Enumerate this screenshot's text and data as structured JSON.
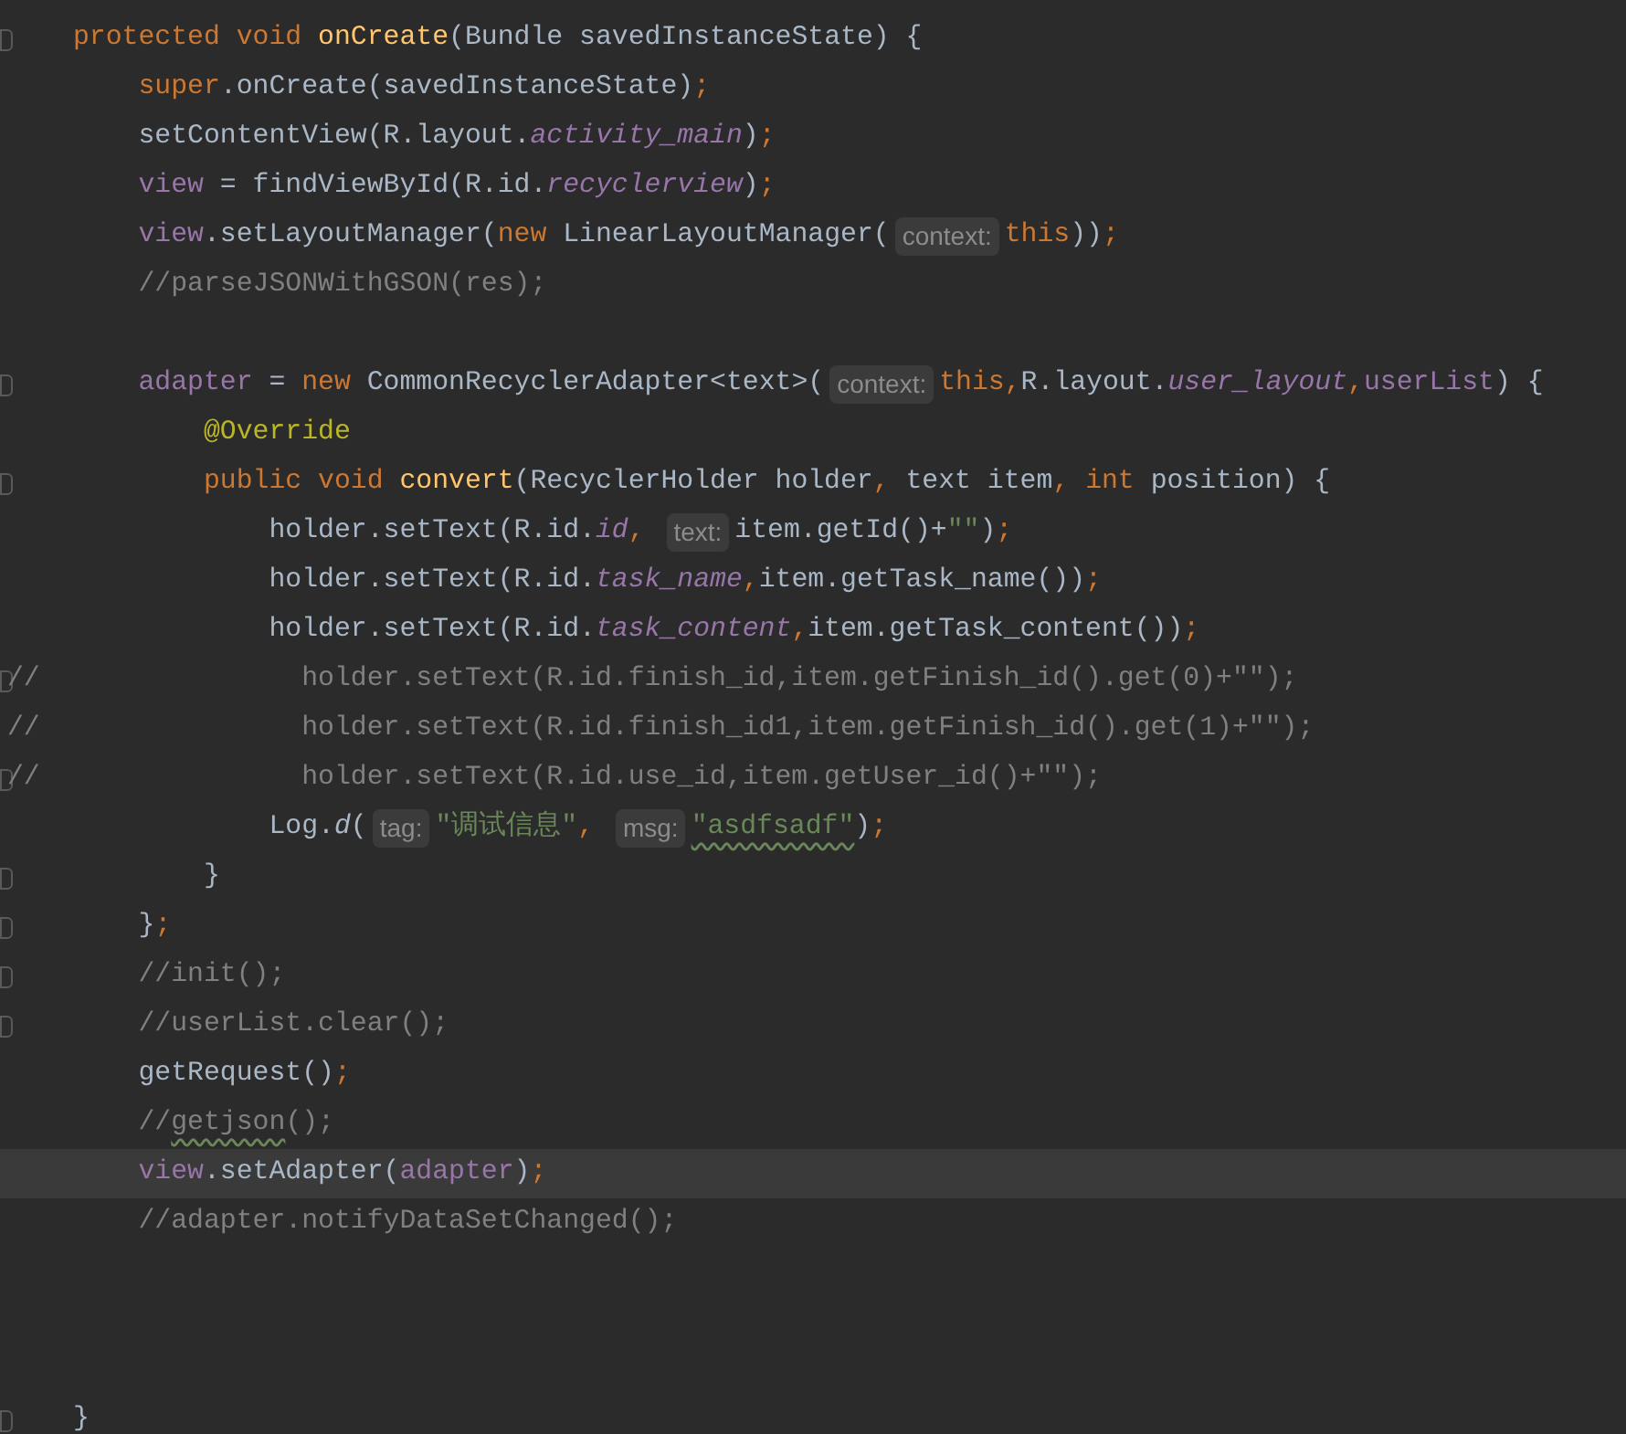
{
  "editor": {
    "lines": [
      {
        "fold": true,
        "current": false,
        "tokens": [
          {
            "kind": "keyword",
            "text": "protected void "
          },
          {
            "kind": "method",
            "text": "onCreate"
          },
          {
            "kind": "plain",
            "text": "(Bundle savedInstanceState) {"
          }
        ]
      },
      {
        "fold": false,
        "current": false,
        "tokens": [
          {
            "kind": "keyword",
            "text": "    super"
          },
          {
            "kind": "plain",
            "text": ".onCreate(savedInstanceState)"
          },
          {
            "kind": "punct",
            "text": ";"
          }
        ]
      },
      {
        "fold": false,
        "current": false,
        "tokens": [
          {
            "kind": "plain",
            "text": "    setContentView(R.layout."
          },
          {
            "kind": "field",
            "text": "activity_main"
          },
          {
            "kind": "plain",
            "text": ")"
          },
          {
            "kind": "punct",
            "text": ";"
          }
        ]
      },
      {
        "fold": false,
        "current": false,
        "tokens": [
          {
            "kind": "var",
            "text": "    view"
          },
          {
            "kind": "plain",
            "text": " = findViewById(R.id."
          },
          {
            "kind": "field",
            "text": "recyclerview"
          },
          {
            "kind": "plain",
            "text": ")"
          },
          {
            "kind": "punct",
            "text": ";"
          }
        ]
      },
      {
        "fold": false,
        "current": false,
        "tokens": [
          {
            "kind": "var",
            "text": "    view"
          },
          {
            "kind": "plain",
            "text": ".setLayoutManager("
          },
          {
            "kind": "keyword",
            "text": "new "
          },
          {
            "kind": "plain",
            "text": "LinearLayoutManager("
          },
          {
            "kind": "hint",
            "text": "context:"
          },
          {
            "kind": "keyword",
            "text": "this"
          },
          {
            "kind": "plain",
            "text": "))"
          },
          {
            "kind": "punct",
            "text": ";"
          }
        ]
      },
      {
        "fold": false,
        "current": false,
        "tokens": [
          {
            "kind": "comment",
            "text": "    //parseJSONWithGSON(res);"
          }
        ]
      },
      {
        "fold": false,
        "current": false
      },
      {
        "fold": true,
        "current": false,
        "tokens": [
          {
            "kind": "var",
            "text": "    adapter"
          },
          {
            "kind": "plain",
            "text": " = "
          },
          {
            "kind": "keyword",
            "text": "new "
          },
          {
            "kind": "plain",
            "text": "CommonRecyclerAdapter<text>("
          },
          {
            "kind": "hint",
            "text": "context:"
          },
          {
            "kind": "keyword",
            "text": "this"
          },
          {
            "kind": "punct",
            "text": ","
          },
          {
            "kind": "plain",
            "text": "R.layout."
          },
          {
            "kind": "field",
            "text": "user_layout"
          },
          {
            "kind": "punct",
            "text": ","
          },
          {
            "kind": "var",
            "text": "userList"
          },
          {
            "kind": "plain",
            "text": ") {"
          }
        ]
      },
      {
        "fold": false,
        "current": false,
        "tokens": [
          {
            "kind": "annotation",
            "text": "        @Override"
          }
        ]
      },
      {
        "fold": true,
        "current": false,
        "tokens": [
          {
            "kind": "keyword",
            "text": "        public void "
          },
          {
            "kind": "method",
            "text": "convert"
          },
          {
            "kind": "plain",
            "text": "(RecyclerHolder holder"
          },
          {
            "kind": "punct",
            "text": ", "
          },
          {
            "kind": "plain",
            "text": "text item"
          },
          {
            "kind": "punct",
            "text": ", "
          },
          {
            "kind": "keyword",
            "text": "int "
          },
          {
            "kind": "plain",
            "text": "position) {"
          }
        ]
      },
      {
        "fold": false,
        "current": false,
        "tokens": [
          {
            "kind": "plain",
            "text": "            holder.setText(R.id."
          },
          {
            "kind": "field",
            "text": "id"
          },
          {
            "kind": "punct",
            "text": ", "
          },
          {
            "kind": "hint",
            "text": "text:"
          },
          {
            "kind": "plain",
            "text": "item.getId()+"
          },
          {
            "kind": "string",
            "text": "\"\""
          },
          {
            "kind": "plain",
            "text": ")"
          },
          {
            "kind": "punct",
            "text": ";"
          }
        ]
      },
      {
        "fold": false,
        "current": false,
        "tokens": [
          {
            "kind": "plain",
            "text": "            holder.setText(R.id."
          },
          {
            "kind": "field",
            "text": "task_name"
          },
          {
            "kind": "punct",
            "text": ","
          },
          {
            "kind": "plain",
            "text": "item.getTask_name())"
          },
          {
            "kind": "punct",
            "text": ";"
          }
        ]
      },
      {
        "fold": false,
        "current": false,
        "tokens": [
          {
            "kind": "plain",
            "text": "            holder.setText(R.id."
          },
          {
            "kind": "field",
            "text": "task_content"
          },
          {
            "kind": "punct",
            "text": ","
          },
          {
            "kind": "plain",
            "text": "item.getTask_content())"
          },
          {
            "kind": "punct",
            "text": ";"
          }
        ]
      },
      {
        "fold": true,
        "current": false,
        "gutter_text": "//",
        "tokens": [
          {
            "kind": "comment",
            "text": "              holder.setText(R.id.finish_id,item.getFinish_id().get(0)+\"\");"
          }
        ]
      },
      {
        "fold": false,
        "current": false,
        "gutter_text": "//",
        "tokens": [
          {
            "kind": "comment",
            "text": "              holder.setText(R.id.finish_id1,item.getFinish_id().get(1)+\"\");"
          }
        ]
      },
      {
        "fold": true,
        "current": false,
        "gutter_text": "//",
        "tokens": [
          {
            "kind": "comment",
            "text": "              holder.setText(R.id.use_id,item.getUser_id()+\"\");"
          }
        ]
      },
      {
        "fold": false,
        "current": false,
        "tokens": [
          {
            "kind": "plain",
            "text": "            Log."
          },
          {
            "kind": "static",
            "text": "d"
          },
          {
            "kind": "plain",
            "text": "("
          },
          {
            "kind": "hint",
            "text": "tag:"
          },
          {
            "kind": "string",
            "text": "\"调试信息\""
          },
          {
            "kind": "punct",
            "text": ", "
          },
          {
            "kind": "hint",
            "text": "msg:"
          },
          {
            "kind": "string",
            "text": "\"asdfsadf\"",
            "typo": true
          },
          {
            "kind": "plain",
            "text": ")"
          },
          {
            "kind": "punct",
            "text": ";"
          }
        ]
      },
      {
        "fold": true,
        "current": false,
        "tokens": [
          {
            "kind": "plain",
            "text": "        }"
          }
        ]
      },
      {
        "fold": true,
        "current": false,
        "tokens": [
          {
            "kind": "plain",
            "text": "    }"
          },
          {
            "kind": "punct",
            "text": ";"
          }
        ]
      },
      {
        "fold": true,
        "current": false,
        "tokens": [
          {
            "kind": "comment",
            "text": "    //init();"
          }
        ]
      },
      {
        "fold": true,
        "current": false,
        "tokens": [
          {
            "kind": "comment",
            "text": "    //userList.clear();"
          }
        ]
      },
      {
        "fold": false,
        "current": false,
        "tokens": [
          {
            "kind": "plain",
            "text": "    getRequest()"
          },
          {
            "kind": "punct",
            "text": ";"
          }
        ]
      },
      {
        "fold": false,
        "current": false,
        "tokens": [
          {
            "kind": "comment",
            "text": "    //"
          },
          {
            "kind": "comment",
            "text": "getjson",
            "typo": true
          },
          {
            "kind": "comment",
            "text": "();"
          }
        ]
      },
      {
        "fold": false,
        "current": true,
        "tokens": [
          {
            "kind": "var",
            "text": "    view"
          },
          {
            "kind": "plain",
            "text": ".setAdapter("
          },
          {
            "kind": "var",
            "text": "adapter"
          },
          {
            "kind": "plain",
            "text": ")"
          },
          {
            "kind": "punct",
            "text": ";"
          }
        ]
      },
      {
        "fold": false,
        "current": false,
        "tokens": [
          {
            "kind": "comment",
            "text": "    //adapter.notifyDataSetChanged();"
          }
        ]
      },
      {
        "fold": false,
        "current": false
      },
      {
        "fold": false,
        "current": false
      },
      {
        "fold": false,
        "current": false
      },
      {
        "fold": true,
        "current": false,
        "tokens": [
          {
            "kind": "plain",
            "text": "}"
          }
        ]
      }
    ]
  }
}
